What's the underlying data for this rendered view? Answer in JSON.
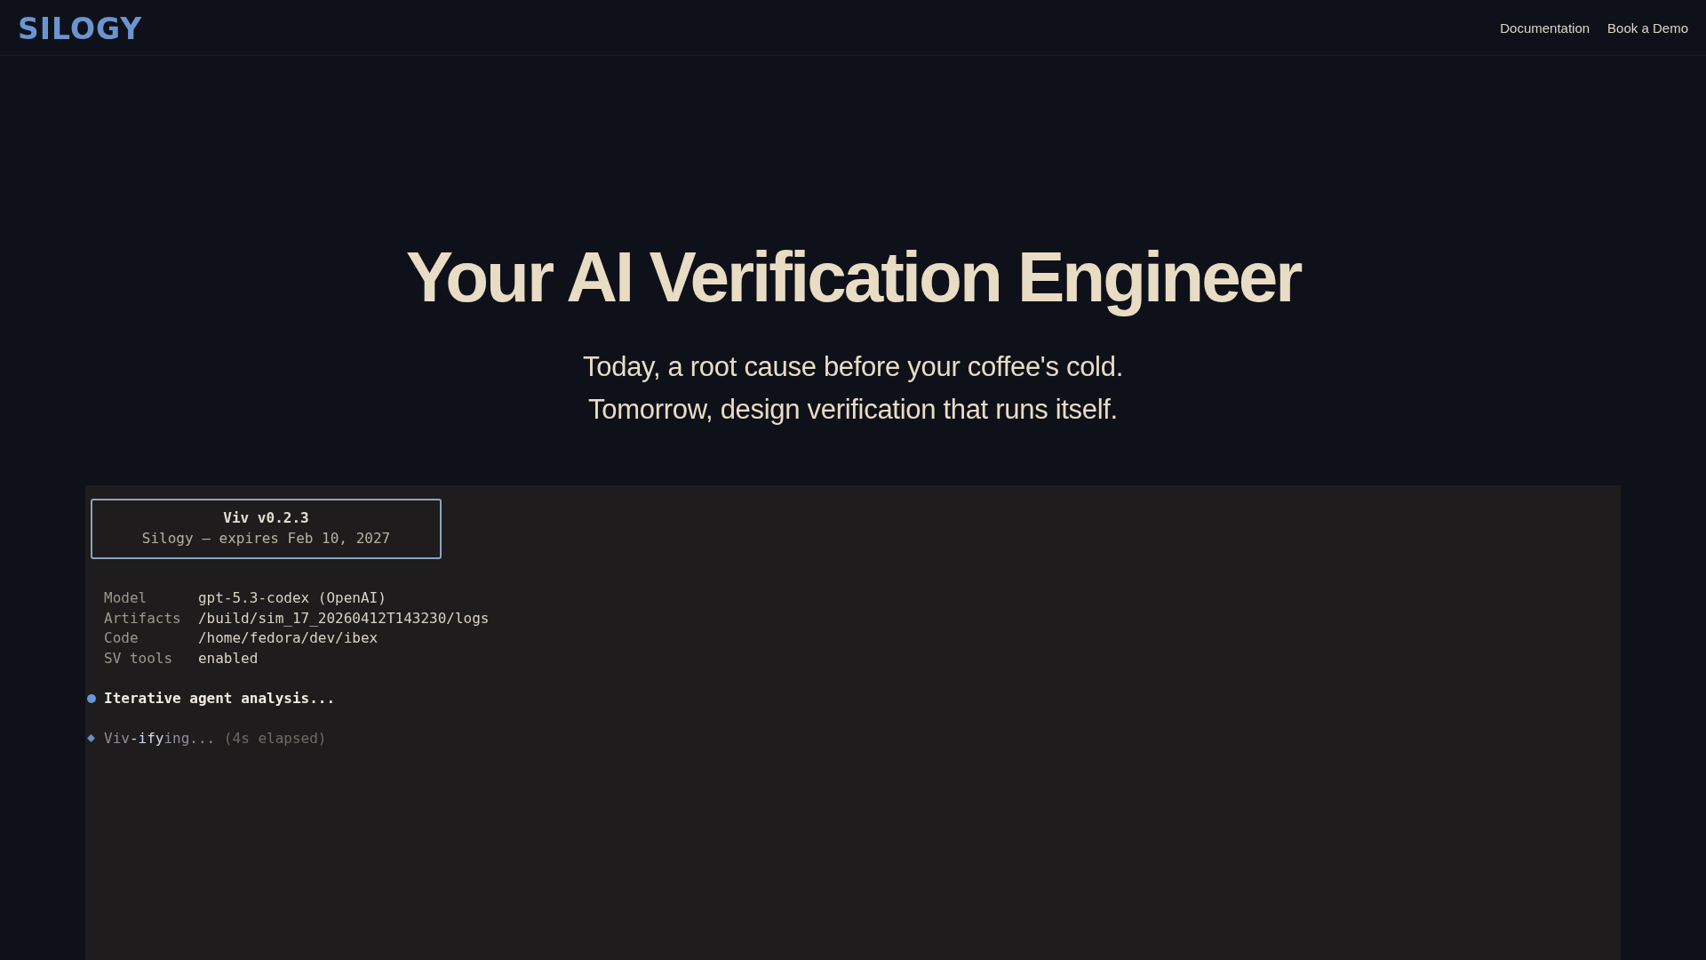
{
  "header": {
    "logo": "SILOGY",
    "nav_links": [
      "Documentation",
      "Book a Demo"
    ]
  },
  "hero": {
    "title": "Your AI Verification Engineer",
    "subtitle_lines": [
      "Today, a root cause before your coffee's cold.",
      "Tomorrow, design verification that runs itself."
    ]
  },
  "terminal": {
    "banner": {
      "title": "Viv v0.2.3",
      "subtitle": "Silogy — expires Feb 10, 2027"
    },
    "info_rows": [
      {
        "label": "Model",
        "value": "gpt-5.3-codex (OpenAI)"
      },
      {
        "label": "Artifacts",
        "value": "/build/sim_17_20260412T143230/logs"
      },
      {
        "label": "Code",
        "value": "/home/fedora/dev/ibex"
      },
      {
        "label": "SV tools",
        "value": "enabled"
      }
    ],
    "status_lines": [
      {
        "kind": "step",
        "text": "Iterative agent analysis..."
      },
      {
        "kind": "progress",
        "text": "Viv**-ify**ing...",
        "elapsed": "(4s elapsed)"
      }
    ]
  }
}
